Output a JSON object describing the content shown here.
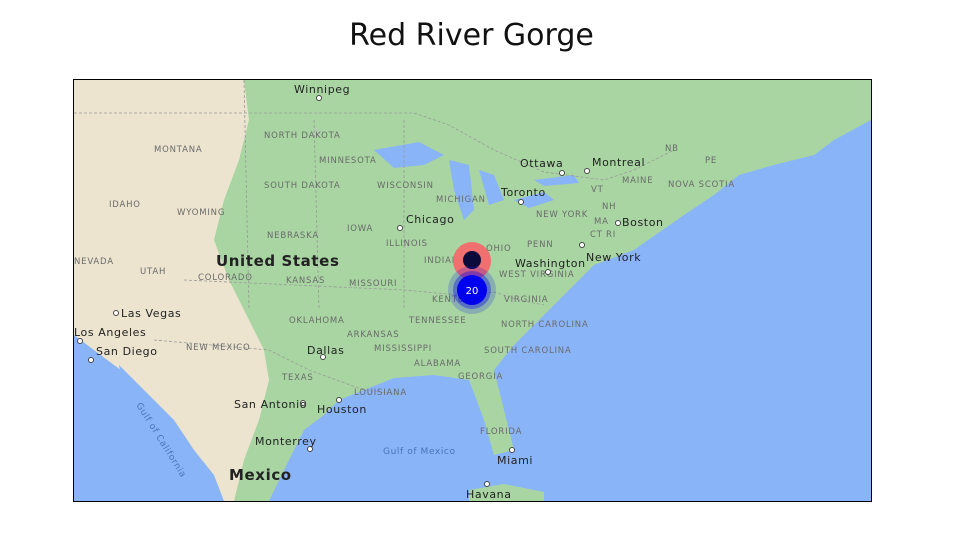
{
  "title": "Red River Gorge",
  "map": {
    "countries": [
      "United States",
      "Mexico"
    ],
    "states": [
      "MONTANA",
      "NORTH DAKOTA",
      "MINNESOTA",
      "WISCONSIN",
      "MICHIGAN",
      "SOUTH DAKOTA",
      "IDAHO",
      "WYOMING",
      "NEBRASKA",
      "IOWA",
      "ILLINOIS",
      "INDIANA",
      "NEVADA",
      "UTAH",
      "COLORADO",
      "KANSAS",
      "MISSOURI",
      "KENTUCKY",
      "OKLAHOMA",
      "ARKANSAS",
      "TENNESSEE",
      "NEW MEXICO",
      "MISSISSIPPI",
      "ALABAMA",
      "TEXAS",
      "LOUISIANA",
      "GEORGIA",
      "FLORIDA",
      "WEST VIRGINIA",
      "VIRGINIA",
      "NORTH CAROLINA",
      "SOUTH CAROLINA",
      "PENN",
      "NEW YORK",
      "VT",
      "NH",
      "MA",
      "CT",
      "RI",
      "MAINE",
      "NB",
      "PE",
      "NOVA SCOTIA",
      "OHIO"
    ],
    "cities": [
      "Winnipeg",
      "Ottawa",
      "Montreal",
      "Toronto",
      "Chicago",
      "Boston",
      "New York",
      "Washington",
      "Las Vegas",
      "Los Angeles",
      "San Diego",
      "Dallas",
      "San Antonio",
      "Houston",
      "Monterrey",
      "Miami",
      "Havana"
    ],
    "water": [
      "Gulf of Mexico",
      "Gulf of California"
    ],
    "highlight_marker": {
      "color": "#f07070",
      "inner_color": "#0b0b3b"
    },
    "cluster_marker": {
      "count": "20",
      "color": "#0000ee"
    }
  }
}
